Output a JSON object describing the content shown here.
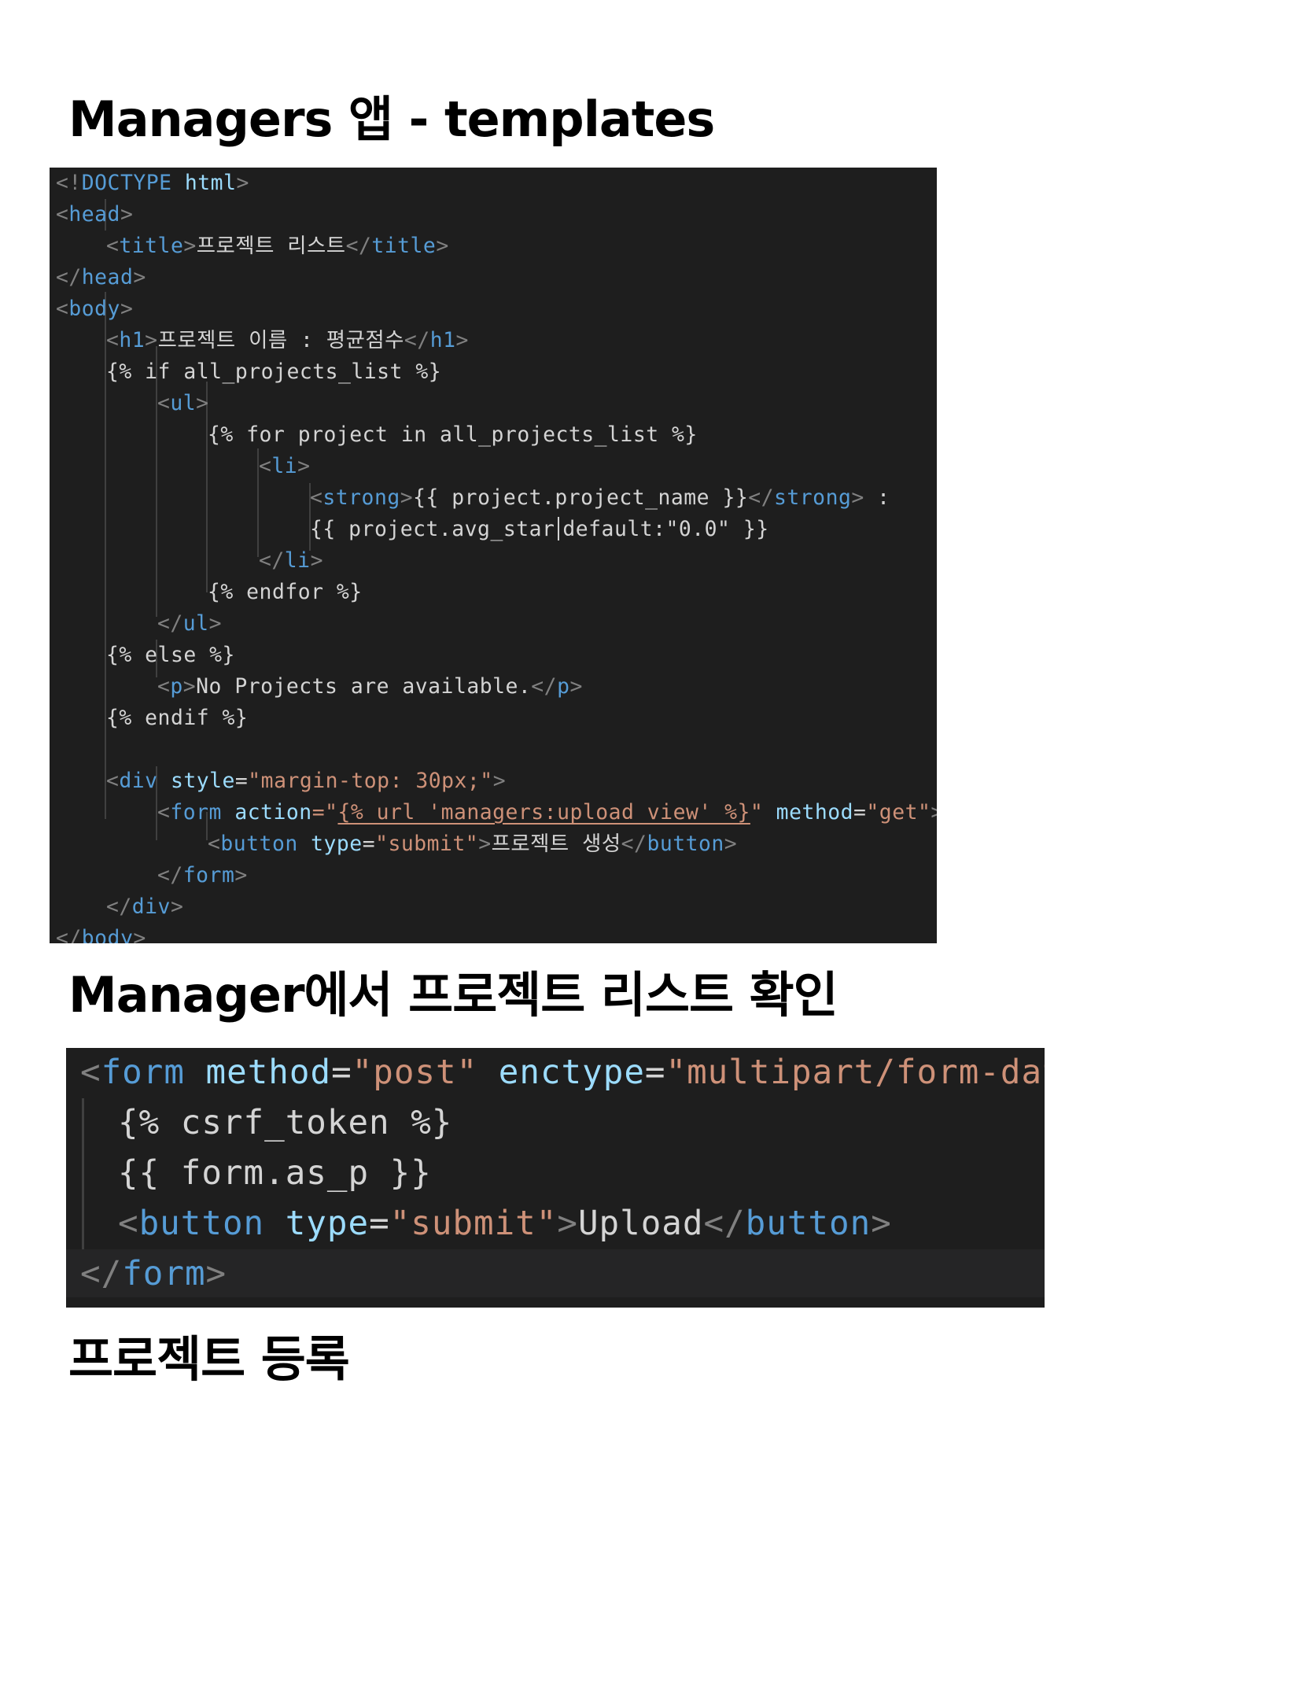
{
  "headings": {
    "templates": "Managers 앱 - templates",
    "list_check": "Manager에서 프로젝트 리스트 확인",
    "register": "프로젝트 등록"
  },
  "code_list_template": {
    "l1": {
      "p1": "<!",
      "p2": "DOCTYPE",
      "p3": " html",
      "p4": ">"
    },
    "l2": {
      "p1": "<",
      "p2": "head",
      "p3": ">"
    },
    "l3": {
      "p1": "<",
      "p2": "title",
      "p3": ">",
      "p4": "프로젝트 리스트",
      "p5": "</",
      "p6": "title",
      "p7": ">"
    },
    "l4": {
      "p1": "</",
      "p2": "head",
      "p3": ">"
    },
    "l5": {
      "p1": "<",
      "p2": "body",
      "p3": ">"
    },
    "l6": {
      "p1": "<",
      "p2": "h1",
      "p3": ">",
      "p4": "프로젝트 이름 : 평균점수",
      "p5": "</",
      "p6": "h1",
      "p7": ">"
    },
    "l7": "{% if all_projects_list %}",
    "l8": {
      "p1": "<",
      "p2": "ul",
      "p3": ">"
    },
    "l9": "{% for project in all_projects_list %}",
    "l10": {
      "p1": "<",
      "p2": "li",
      "p3": ">"
    },
    "l11": {
      "p1": "<",
      "p2": "strong",
      "p3": ">",
      "p4": "{{ project.project_name }}",
      "p5": "</",
      "p6": "strong",
      "p7": ">",
      "p8": " :"
    },
    "l12a": "{{ project.avg_star",
    "l12b": "default:\"0.0\" }}",
    "l13": {
      "p1": "</",
      "p2": "li",
      "p3": ">"
    },
    "l14": "{% endfor %}",
    "l15": {
      "p1": "</",
      "p2": "ul",
      "p3": ">"
    },
    "l16": "{% else %}",
    "l17": {
      "p1": "<",
      "p2": "p",
      "p3": ">",
      "p4": "No Projects are available.",
      "p5": "</",
      "p6": "p",
      "p7": ">"
    },
    "l18": "{% endif %}",
    "l19": {
      "p1": "<",
      "p2": "div",
      "p3": " style",
      "p4": "=",
      "p5": "\"margin-top: 30px;\"",
      "p6": ">"
    },
    "l20": {
      "p1": "<",
      "p2": "form",
      "p3": " action",
      "p4": "=\"",
      "p5": "{% url 'managers:upload_view' %}",
      "p6": "\"",
      "p7": " method",
      "p8": "=",
      "p9": "\"get\"",
      "p10": ">"
    },
    "l21": {
      "p1": "<",
      "p2": "button",
      "p3": " type",
      "p4": "=",
      "p5": "\"submit\"",
      "p6": ">",
      "p7": "프로젝트 생성",
      "p8": "</",
      "p9": "button",
      "p10": ">"
    },
    "l22": {
      "p1": "</",
      "p2": "form",
      "p3": ">"
    },
    "l23": {
      "p1": "</",
      "p2": "div",
      "p3": ">"
    },
    "l24": {
      "p1": "</",
      "p2": "body",
      "p3": ">"
    }
  },
  "code_upload_form": {
    "l1": {
      "p1": "<",
      "p2": "form",
      "p3": " method",
      "p4": "=",
      "p5": "\"post\"",
      "p6": " enctype",
      "p7": "=",
      "p8": "\"multipart/form-data\"",
      "p9": ">"
    },
    "l2": "{% csrf_token %}",
    "l3": "{{ form.as_p }}",
    "l4": {
      "p1": "<",
      "p2": "button",
      "p3": " type",
      "p4": "=",
      "p5": "\"submit\"",
      "p6": ">",
      "p7": "Upload",
      "p8": "</",
      "p9": "button",
      "p10": ">"
    },
    "l5": {
      "p1": "</",
      "p2": "form",
      "p3": ">"
    }
  },
  "colors": {
    "editor_background": "#1e1e1e",
    "tag_bracket": "#808080",
    "tag_name": "#569cd6",
    "attribute": "#9cdcfe",
    "string": "#ce9178",
    "text": "#d4d4d4"
  }
}
